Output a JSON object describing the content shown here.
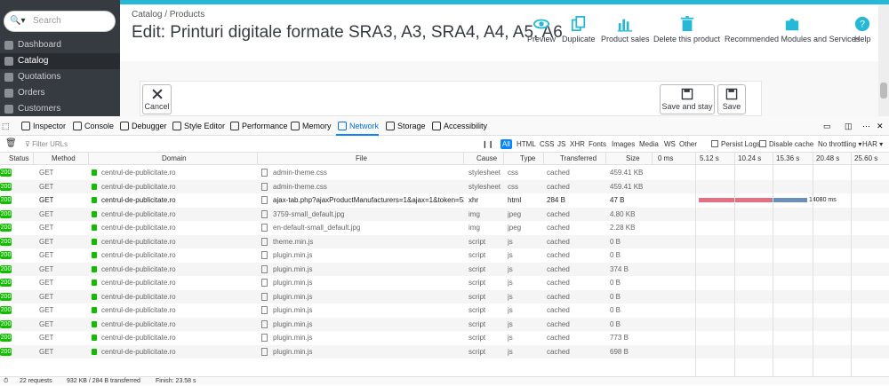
{
  "sidebar": {
    "search_placeholder": "Search",
    "items": [
      {
        "label": "Dashboard"
      },
      {
        "label": "Catalog"
      },
      {
        "label": "Quotations"
      },
      {
        "label": "Orders"
      },
      {
        "label": "Customers"
      }
    ]
  },
  "header": {
    "breadcrumb": "Catalog  /  Products",
    "title": "Edit: Printuri digitale formate SRA3, A3, SRA4, A4, A5, A6",
    "toolbar": {
      "preview": "Preview",
      "duplicate": "Duplicate",
      "product_sales": "Product sales",
      "delete": "Delete this product",
      "modules": "Recommended Modules and Services",
      "help": "Help"
    }
  },
  "footer_buttons": {
    "cancel": "Cancel",
    "save_and_stay": "Save and stay",
    "save": "Save"
  },
  "devtools": {
    "tabs": {
      "inspector": "Inspector",
      "console": "Console",
      "debugger": "Debugger",
      "style_editor": "Style Editor",
      "performance": "Performance",
      "memory": "Memory",
      "network": "Network",
      "storage": "Storage",
      "accessibility": "Accessibility"
    },
    "filter_placeholder": "Filter URLs",
    "types": {
      "all": "All",
      "html": "HTML",
      "css": "CSS",
      "js": "JS",
      "xhr": "XHR",
      "fonts": "Fonts",
      "images": "Images",
      "media": "Media",
      "ws": "WS",
      "other": "Other"
    },
    "persist_logs": "Persist Logs",
    "disable_cache": "Disable cache",
    "throttling": "No throttling ▾",
    "har": "HAR ▾",
    "columns": {
      "status": "Status",
      "method": "Method",
      "domain": "Domain",
      "file": "File",
      "cause": "Cause",
      "type": "Type",
      "transferred": "Transferred",
      "size": "Size"
    },
    "ticks": [
      "0 ms",
      "5.12 s",
      "10.24 s",
      "15.36 s",
      "20.48 s",
      "25.60 s"
    ],
    "waterfall_label": "14080 ms",
    "rows": [
      {
        "status": "200",
        "method": "GET",
        "domain": "centrul-de-publicitate.ro",
        "file": "admin-theme.css",
        "cause": "stylesheet",
        "type": "css",
        "transferred": "cached",
        "size": "459.41 KB"
      },
      {
        "status": "200",
        "method": "GET",
        "domain": "centrul-de-publicitate.ro",
        "file": "admin-theme.css",
        "cause": "stylesheet",
        "type": "css",
        "transferred": "cached",
        "size": "459.41 KB"
      },
      {
        "status": "200",
        "method": "GET",
        "domain": "centrul-de-publicitate.ro",
        "file": "ajax-tab.php?ajaxProductManufacturers=1&ajax=1&token=5334...",
        "cause": "xhr",
        "type": "html",
        "transferred": "284 B",
        "size": "47 B"
      },
      {
        "status": "200",
        "method": "GET",
        "domain": "centrul-de-publicitate.ro",
        "file": "3759-small_default.jpg",
        "cause": "img",
        "type": "jpeg",
        "transferred": "cached",
        "size": "4.80 KB"
      },
      {
        "status": "200",
        "method": "GET",
        "domain": "centrul-de-publicitate.ro",
        "file": "en-default-small_default.jpg",
        "cause": "img",
        "type": "jpeg",
        "transferred": "cached",
        "size": "2.28 KB"
      },
      {
        "status": "200",
        "method": "GET",
        "domain": "centrul-de-publicitate.ro",
        "file": "theme.min.js",
        "cause": "script",
        "type": "js",
        "transferred": "cached",
        "size": "0 B"
      },
      {
        "status": "200",
        "method": "GET",
        "domain": "centrul-de-publicitate.ro",
        "file": "plugin.min.js",
        "cause": "script",
        "type": "js",
        "transferred": "cached",
        "size": "0 B"
      },
      {
        "status": "200",
        "method": "GET",
        "domain": "centrul-de-publicitate.ro",
        "file": "plugin.min.js",
        "cause": "script",
        "type": "js",
        "transferred": "cached",
        "size": "374 B"
      },
      {
        "status": "200",
        "method": "GET",
        "domain": "centrul-de-publicitate.ro",
        "file": "plugin.min.js",
        "cause": "script",
        "type": "js",
        "transferred": "cached",
        "size": "0 B"
      },
      {
        "status": "200",
        "method": "GET",
        "domain": "centrul-de-publicitate.ro",
        "file": "plugin.min.js",
        "cause": "script",
        "type": "js",
        "transferred": "cached",
        "size": "0 B"
      },
      {
        "status": "200",
        "method": "GET",
        "domain": "centrul-de-publicitate.ro",
        "file": "plugin.min.js",
        "cause": "script",
        "type": "js",
        "transferred": "cached",
        "size": "0 B"
      },
      {
        "status": "200",
        "method": "GET",
        "domain": "centrul-de-publicitate.ro",
        "file": "plugin.min.js",
        "cause": "script",
        "type": "js",
        "transferred": "cached",
        "size": "0 B"
      },
      {
        "status": "200",
        "method": "GET",
        "domain": "centrul-de-publicitate.ro",
        "file": "plugin.min.js",
        "cause": "script",
        "type": "js",
        "transferred": "cached",
        "size": "773 B"
      },
      {
        "status": "200",
        "method": "GET",
        "domain": "centrul-de-publicitate.ro",
        "file": "plugin.min.js",
        "cause": "script",
        "type": "js",
        "transferred": "cached",
        "size": "698 B"
      }
    ],
    "status_bar": {
      "requests": "22 requests",
      "transferred": "932 KB / 284 B transferred",
      "finish": "Finish: 23.58 s"
    }
  },
  "colors": {
    "sidebar": "#363a41",
    "accent": "#25b9d7",
    "toolbar_icon": "#25b9d7",
    "status_ok": "#12bc00",
    "network_tab": "#0a84ff",
    "waterfall_wait": "#e5707f",
    "waterfall_receive": "#6a8fb9"
  }
}
